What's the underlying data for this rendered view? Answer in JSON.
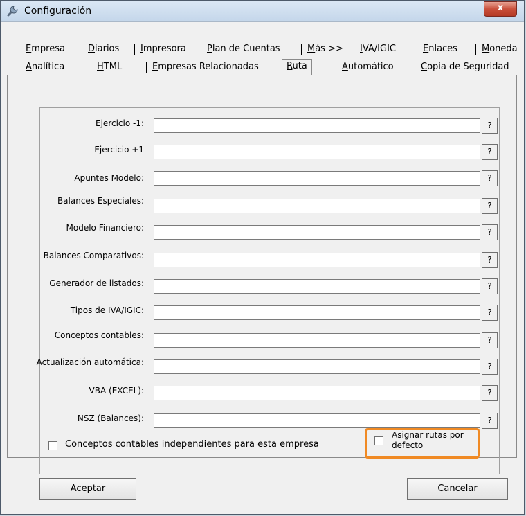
{
  "window": {
    "title": "Configuración",
    "close_label": "x"
  },
  "tabs_row1": [
    {
      "pre": "",
      "u": "E",
      "post": "mpresa"
    },
    {
      "pre": "",
      "u": "D",
      "post": "iarios"
    },
    {
      "pre": "",
      "u": "I",
      "post": "mpresora"
    },
    {
      "pre": "",
      "u": "P",
      "post": "lan de Cuentas"
    },
    {
      "pre": "",
      "u": "M",
      "post": "ás >>"
    },
    {
      "pre": "",
      "u": "I",
      "post": "VA/IGIC"
    },
    {
      "pre": "",
      "u": "E",
      "post": "nlaces"
    },
    {
      "pre": "",
      "u": "M",
      "post": "oneda"
    }
  ],
  "tabs_row2": [
    {
      "pre": "",
      "u": "A",
      "post": "nalítica"
    },
    {
      "pre": "",
      "u": "H",
      "post": "TML"
    },
    {
      "pre": "",
      "u": "E",
      "post": "mpresas Relacionadas"
    },
    {
      "pre": "",
      "u": "R",
      "post": "uta"
    },
    {
      "pre": "",
      "u": "A",
      "post": "utomático"
    },
    {
      "pre": "",
      "u": "C",
      "post": "opia de Seguridad"
    }
  ],
  "fields": [
    {
      "label": "Ejercicio -1:",
      "value": ""
    },
    {
      "label": "Ejercicio +1",
      "value": ""
    },
    {
      "label": "Apuntes Modelo:",
      "value": ""
    },
    {
      "label": "Balances Especiales:",
      "value": ""
    },
    {
      "label": "Modelo Financiero:",
      "value": ""
    },
    {
      "label": "Balances Comparativos:",
      "value": ""
    },
    {
      "label": "Generador de listados:",
      "value": ""
    },
    {
      "label": "Tipos de IVA/IGIC:",
      "value": ""
    },
    {
      "label": "Conceptos contables:",
      "value": ""
    },
    {
      "label": "Actualización automática:",
      "value": ""
    },
    {
      "label": "VBA (EXCEL):",
      "value": ""
    },
    {
      "label": "NSZ (Balances):",
      "value": ""
    }
  ],
  "help_label": "?",
  "checkbox_independent": {
    "label": "Conceptos contables independientes para esta empresa",
    "checked": false
  },
  "checkbox_default_paths": {
    "label_line1": "Asignar rutas por",
    "label_line2": "defecto",
    "checked": false
  },
  "buttons": {
    "accept": {
      "u": "A",
      "post": "ceptar"
    },
    "cancel": {
      "u": "C",
      "post": "ancelar"
    }
  },
  "colors": {
    "highlight": "#f08a24",
    "close_button": "#c9503c"
  }
}
